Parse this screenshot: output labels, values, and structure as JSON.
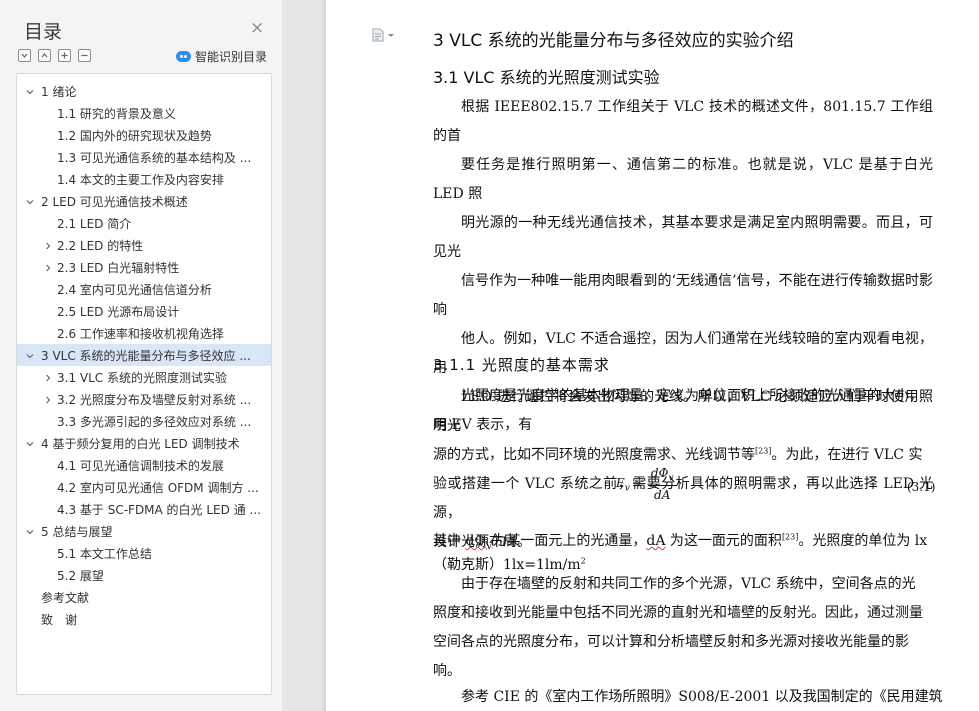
{
  "toc": {
    "title": "目录",
    "close_label": "×",
    "smart_label": "智能识别目录",
    "items": [
      {
        "label": "1 绪论",
        "level": 1,
        "chevron": "down",
        "active": false
      },
      {
        "label": "1.1 研究的背景及意义",
        "level": 2,
        "chevron": "",
        "active": false
      },
      {
        "label": "1.2 国内外的研究现状及趋势",
        "level": 2,
        "chevron": "",
        "active": false
      },
      {
        "label": "1.3 可见光通信系统的基本结构及 ...",
        "level": 2,
        "chevron": "",
        "active": false
      },
      {
        "label": "1.4 本文的主要工作及内容安排",
        "level": 2,
        "chevron": "",
        "active": false
      },
      {
        "label": "2 LED 可见光通信技术概述",
        "level": 1,
        "chevron": "down",
        "active": false
      },
      {
        "label": "2.1 LED 简介",
        "level": 2,
        "chevron": "",
        "active": false
      },
      {
        "label": "2.2 LED 的特性",
        "level": 2,
        "chevron": "right",
        "active": false
      },
      {
        "label": "2.3 LED 白光辐射特性",
        "level": 2,
        "chevron": "right",
        "active": false
      },
      {
        "label": "2.4 室内可见光通信信道分析",
        "level": 2,
        "chevron": "",
        "active": false
      },
      {
        "label": "2.5 LED 光源布局设计",
        "level": 2,
        "chevron": "",
        "active": false
      },
      {
        "label": "2.6 工作速率和接收机视角选择",
        "level": 2,
        "chevron": "",
        "active": false
      },
      {
        "label": "3 VLC 系统的光能量分布与多径效应 ...",
        "level": 1,
        "chevron": "down",
        "active": true
      },
      {
        "label": "3.1 VLC 系统的光照度测试实验",
        "level": 2,
        "chevron": "right",
        "active": false
      },
      {
        "label": "3.2 光照度分布及墙壁反射对系统 ...",
        "level": 2,
        "chevron": "right",
        "active": false
      },
      {
        "label": "3.3 多光源引起的多径效应对系统 ...",
        "level": 2,
        "chevron": "",
        "active": false
      },
      {
        "label": "4 基于频分复用的白光 LED 调制技术",
        "level": 1,
        "chevron": "down",
        "active": false
      },
      {
        "label": "4.1 可见光通信调制技术的发展",
        "level": 2,
        "chevron": "",
        "active": false
      },
      {
        "label": "4.2 室内可见光通信 OFDM 调制方 ...",
        "level": 2,
        "chevron": "",
        "active": false
      },
      {
        "label": "4.3 基于 SC-FDMA 的白光 LED 通 ...",
        "level": 2,
        "chevron": "",
        "active": false
      },
      {
        "label": "5 总结与展望",
        "level": 1,
        "chevron": "down",
        "active": false
      },
      {
        "label": "5.1 本文工作总结",
        "level": 2,
        "chevron": "",
        "active": false
      },
      {
        "label": "5.2 展望",
        "level": 2,
        "chevron": "",
        "active": false
      },
      {
        "label": "参考文献",
        "level": 1,
        "chevron": "",
        "active": false
      },
      {
        "label": "致　谢",
        "level": 1,
        "chevron": "",
        "active": false
      }
    ]
  },
  "doc": {
    "h1": "3 VLC 系统的光能量分布与多径效应的实验介绍",
    "h2": "3.1 VLC 系统的光照度测试实验",
    "p1_lines": [
      "根据 IEEE802.15.7 工作组关于 VLC 技术的概述文件，801.15.7 工作组的首",
      "要任务是推行照明第一、通信第二的标准。也就是说，VLC 是基于白光 LED 照",
      "明光源的一种无线光通信技术，其基本要求是满足室内照明需要。而且，可见光",
      "信号作为一种唯一能用肉眼看到的‘无线通信’信号，不能在进行传输数据时影响",
      "他人。例如，VLC 不适合遥控，因为人们通常在光线较暗的室内观看电视，用",
      "LED 进行遥控将会发出闪烁的光线。所以，VLC 必须适应人们平时使用照明光"
    ],
    "p1_line7_pre": "源的方式，比如不同环境的光照度需求、光线调节等",
    "p1_line7_ref": "[23]",
    "p1_line7_post": "。为此，在进行 VLC 实",
    "p1_lines_tail": [
      "验或搭建一个 VLC 系统之前，需要分析具体的照明需求，再以此选择 LED 光源，",
      "设计光源布局。"
    ],
    "h3": "3.1.1 光照度的基本需求",
    "p2_lines": [
      "光照度是光度学的基本物理量，定义为单位面积上所接收的光通量的大小，",
      "用 EV 表示，有"
    ],
    "eq_lhs": "E",
    "eq_lhs_sub": "v",
    "eq_equals": "=",
    "eq_num": "dΦ",
    "eq_num_sub": "v",
    "eq_den": "dA",
    "eq_number": "(3.1)",
    "p3_pre": "其中 ",
    "p3_dphi": "dΦ",
    "p3_dphi_sub": "V",
    "p3_mid": "为某一面元上的光通量，",
    "p3_da": "dA",
    "p3_mid2": " 为这一面元的面积",
    "p3_ref": "[23]",
    "p3_post": "。光照度的单位为 lx",
    "p3_line2": "（勒克斯）1lx=1lm/m",
    "p3_sup": "2",
    "p4_lines": [
      "由于存在墙壁的反射和共同工作的多个光源，VLC 系统中，空间各点的光",
      "照度和接收到光能量中包括不同光源的直射光和墙壁的反射光。因此，通过测量",
      "空间各点的光照度分布，可以计算和分析墙壁反射和多光源对接收光能量的影",
      "响。"
    ],
    "p5": "参考 CIE 的《室内工作场所照明》S008/E-2001 以及我国制定的《民用建筑"
  }
}
